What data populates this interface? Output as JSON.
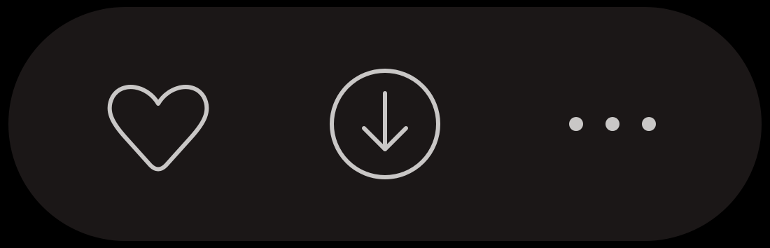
{
  "toolbar": {
    "actions": [
      {
        "name": "like",
        "icon": "heart-outline-icon"
      },
      {
        "name": "download",
        "icon": "download-circle-icon"
      },
      {
        "name": "more",
        "icon": "more-horizontal-icon"
      }
    ]
  },
  "colors": {
    "background": "#000000",
    "pill": "#1b1717",
    "icon": "#c9c7c6"
  }
}
